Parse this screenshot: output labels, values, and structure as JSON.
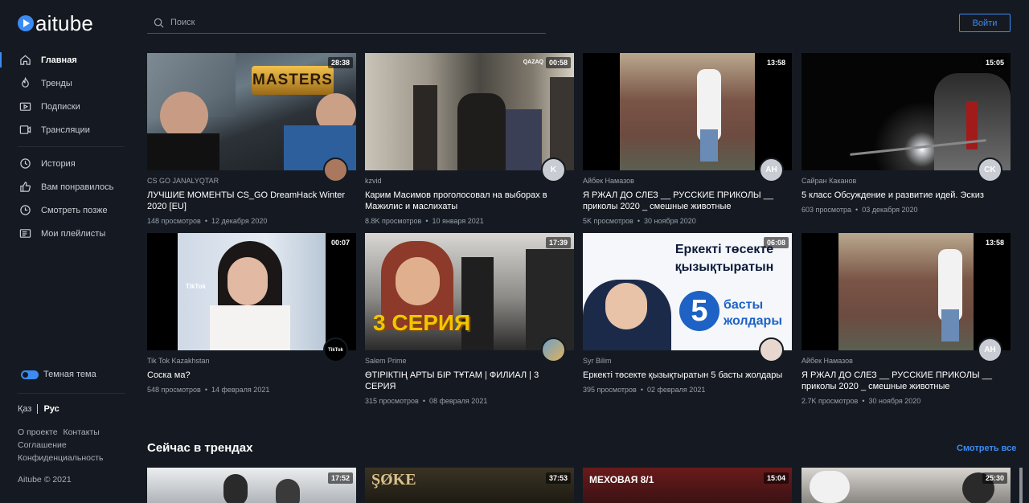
{
  "brand": {
    "name": "aitube",
    "accent": "#3d8bf2"
  },
  "header": {
    "search_placeholder": "Поиск",
    "login_label": "Войти"
  },
  "sidebar": {
    "nav_main": [
      {
        "label": "Главная",
        "icon": "home-icon",
        "active": true
      },
      {
        "label": "Тренды",
        "icon": "flame-icon"
      },
      {
        "label": "Подписки",
        "icon": "subscriptions-icon"
      },
      {
        "label": "Трансляции",
        "icon": "broadcast-icon"
      }
    ],
    "nav_library": [
      {
        "label": "История",
        "icon": "history-icon"
      },
      {
        "label": "Вам понравилось",
        "icon": "thumb-up-icon"
      },
      {
        "label": "Смотреть позже",
        "icon": "clock-icon"
      },
      {
        "label": "Мои плейлисты",
        "icon": "playlist-icon"
      }
    ],
    "theme_label": "Темная тема",
    "lang_kaz": "Қаз",
    "lang_rus": "Рус",
    "links": {
      "about": "О проекте",
      "contacts": "Контакты",
      "agreement": "Соглашение",
      "privacy": "Конфиденциальность"
    },
    "copyright": "Aitube © 2021"
  },
  "videos": [
    {
      "duration": "28:38",
      "channel": "CS GO JANALYQTAR",
      "title": "ЛУЧШИЕ МОМЕНТЫ CS_GO DreamHack Winter 2020 [EU]",
      "views": "148 просмотров",
      "date": "12 декабря 2020",
      "avatar": ""
    },
    {
      "duration": "00:58",
      "channel": "kzvid",
      "title": "Карим Масимов проголосовал на выборах в Мажилис и маслихаты",
      "views": "8.8K просмотров",
      "date": "10 января 2021",
      "avatar": "K"
    },
    {
      "duration": "13:58",
      "channel": "Айбек Намазов",
      "title": "Я РЖАЛ ДО СЛЕЗ __ РУССКИЕ ПРИКОЛЫ __ приколы 2020 _ смешные животные",
      "views": "5K просмотров",
      "date": "30 ноября 2020",
      "avatar": "AH"
    },
    {
      "duration": "15:05",
      "channel": "Сайран Каканов",
      "title": "5 класс Обсуждение и развитие идей. Эскиз",
      "views": "603 просмотра",
      "date": "03 декабря 2020",
      "avatar": "CK"
    },
    {
      "duration": "00:07",
      "channel": "Tik Tok Kazakhstan",
      "title": "Соска ма?",
      "views": "548 просмотров",
      "date": "14 февраля 2021",
      "avatar": "TikTok"
    },
    {
      "duration": "17:39",
      "channel": "Salem Prime",
      "title": "ӨТІРІКТІҢ АРТЫ БІР ТҰТАМ | ФИЛИАЛ | 3 СЕРИЯ",
      "views": "315 просмотров",
      "date": "08 февраля 2021",
      "avatar": ""
    },
    {
      "duration": "06:08",
      "channel": "Syr Bilim",
      "title": "Еркекті төсекте қызықтыратын 5 басты жолдары",
      "views": "395 просмотров",
      "date": "02 февраля 2021",
      "avatar": ""
    },
    {
      "duration": "13:58",
      "channel": "Айбек Намазов",
      "title": "Я РЖАЛ ДО СЛЕЗ __ РУССКИЕ ПРИКОЛЫ __ приколы 2020 _ смешные животные",
      "views": "2.7K просмотров",
      "date": "30 ноября 2020",
      "avatar": "AH"
    }
  ],
  "thumb_text": {
    "masters": "MASTERS",
    "qazaq": "QAZAQ",
    "tiktok": "TikTok",
    "seriya": "3 СЕРИЯ",
    "yerkekti": "Еркекті төсекте қызықтыратын",
    "five": "5",
    "basty": "басты жолдары"
  },
  "trending": {
    "section_title": "Сейчас в трендах",
    "see_all": "Смотреть все",
    "items": [
      {
        "duration": "17:52"
      },
      {
        "duration": "37:53",
        "overlay": "ŞØKE"
      },
      {
        "duration": "15:04",
        "overlay": "МЕХОВАЯ 8/1"
      },
      {
        "duration": "25:30"
      }
    ]
  }
}
